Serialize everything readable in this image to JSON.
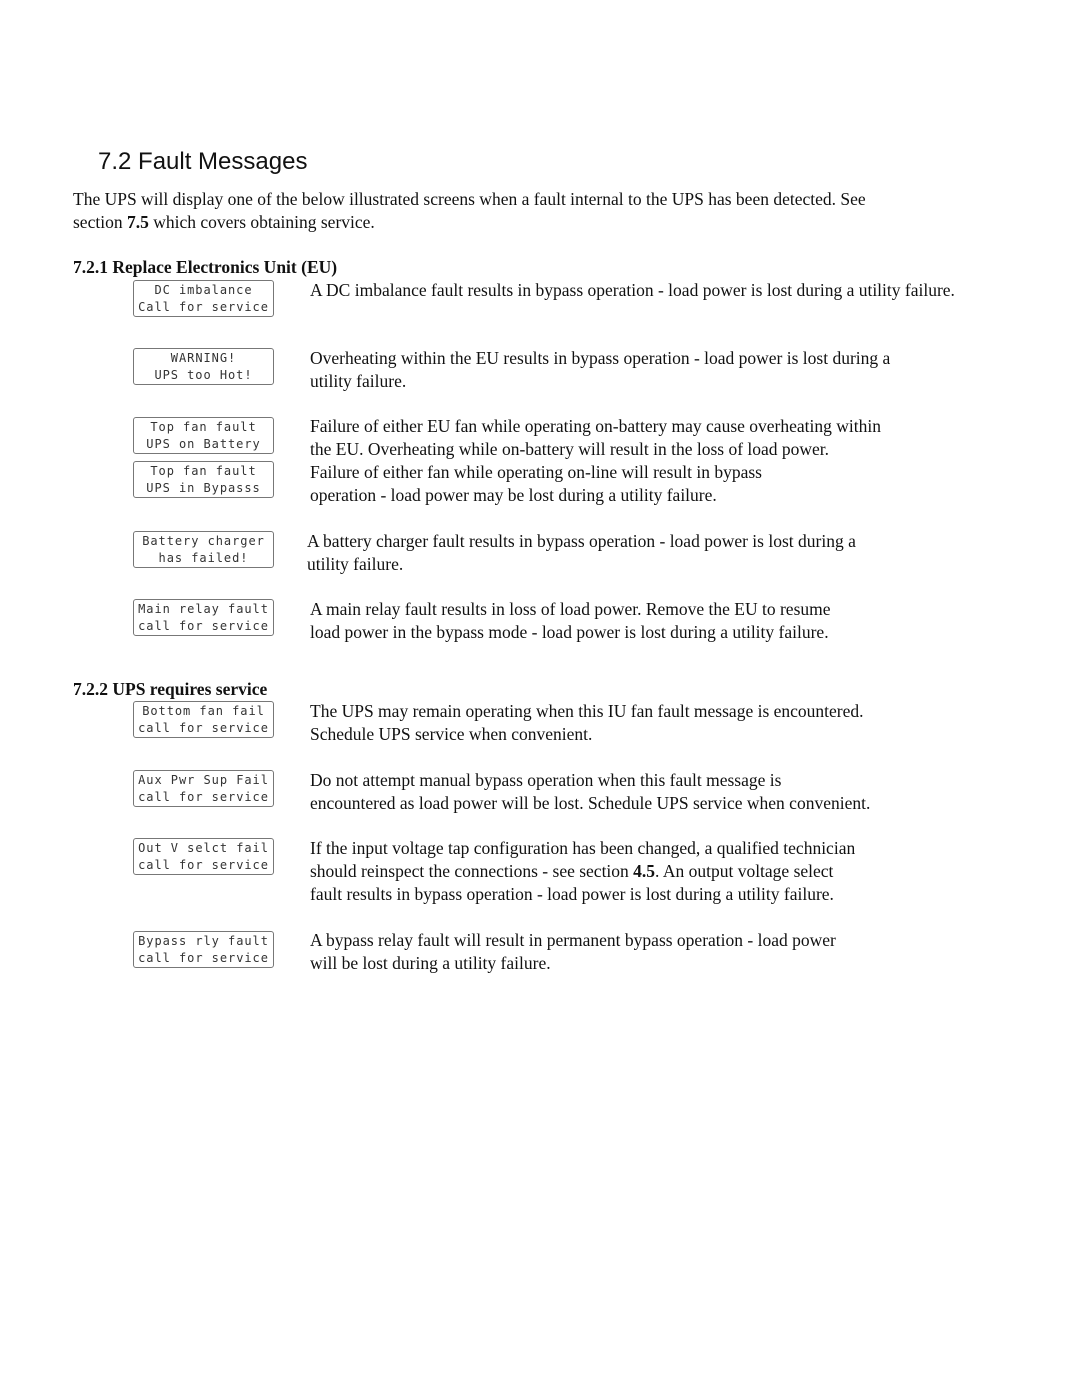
{
  "title": "7.2 Fault Messages",
  "intro": {
    "line1": "The UPS will display one of the below illustrated screens when a fault internal to the UPS has been detected. See",
    "line2_pre": "section ",
    "line2_bold": "7.5",
    "line2_post": " which covers obtaining service."
  },
  "section1": {
    "heading": "7.2.1 Replace Electronics Unit (EU)",
    "items": [
      {
        "lcd": [
          "DC imbalance",
          "Call for service"
        ],
        "text": [
          "A DC imbalance fault results in bypass operation - load power is lost during a utility failure."
        ]
      },
      {
        "lcd": [
          "WARNING!",
          "UPS too Hot!"
        ],
        "text": [
          "Overheating within the EU results in bypass operation - load power is lost during a",
          "utility failure."
        ]
      },
      {
        "lcd": [
          "Top fan fault",
          "UPS on Battery"
        ],
        "text": [
          "Failure of either EU fan while operating on-battery may cause overheating within",
          "the EU. Overheating while on-battery will result in the loss of load power."
        ]
      },
      {
        "lcd": [
          "Top fan fault",
          "UPS in Bypasss"
        ],
        "text": [
          "Failure of either fan while operating on-line will result in bypass",
          "operation - load power may be lost during a utility failure."
        ]
      },
      {
        "lcd": [
          "Battery charger",
          "has failed!"
        ],
        "text": [
          "A battery charger fault results in bypass operation - load power is lost during a",
          "utility failure."
        ]
      },
      {
        "lcd": [
          "Main relay fault",
          "call for service"
        ],
        "text": [
          "A main relay fault results in loss of load power. Remove the EU to resume",
          "load power in the bypass mode - load power is lost during a utility failure."
        ]
      }
    ]
  },
  "section2": {
    "heading": "7.2.2 UPS requires service",
    "items": [
      {
        "lcd": [
          "Bottom fan fail",
          "call for service"
        ],
        "text": [
          "The UPS may remain operating when this IU fan fault message is encountered.",
          "Schedule UPS service when convenient."
        ]
      },
      {
        "lcd": [
          "Aux Pwr Sup Fail",
          "call for service"
        ],
        "text": [
          "Do not attempt manual bypass operation when this fault message is",
          "encountered as load power will be lost. Schedule UPS service when convenient."
        ]
      },
      {
        "lcd": [
          "Out V selct fail",
          "call for service"
        ],
        "text": [
          "If the input voltage tap configuration has been changed, a qualified technician",
          "should reinspect the connections - see section |4.5|. An output voltage select",
          "fault results in bypass operation - load power is lost during a utility failure."
        ]
      },
      {
        "lcd": [
          "Bypass rly fault",
          "call for service"
        ],
        "text": [
          "A bypass relay fault will result in permanent bypass operation - load power",
          "will be lost during a utility failure."
        ]
      }
    ]
  }
}
